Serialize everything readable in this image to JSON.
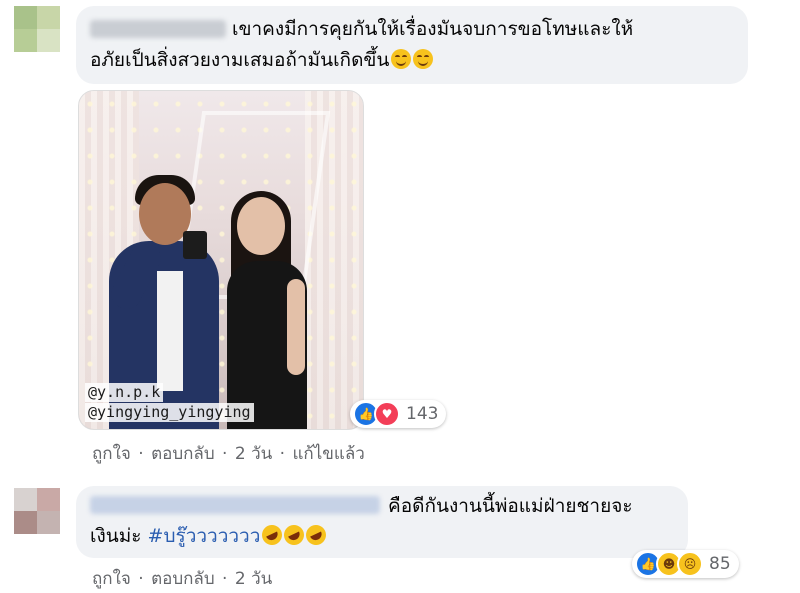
{
  "comments": [
    {
      "text_line1": "เขาคงมีการคุยกันให้เรื่องมันจบการขอโทษและให้",
      "text_line2": "อภัยเป็นสิ่งสวยงามเสมอถ้ามันเกิดขึ้น",
      "emojis": [
        "smiling-face-icon",
        "smiling-face-icon"
      ],
      "attachment": {
        "watermarks": [
          "@y.n.p.k",
          "@yingying_yingying"
        ]
      },
      "reactions": {
        "icons": [
          "like-icon",
          "love-icon"
        ],
        "count": "143"
      },
      "actions": {
        "like": "ถูกใจ",
        "reply": "ตอบกลับ",
        "time": "2 วัน",
        "edited": "แก้ไขแล้ว",
        "sep": "·"
      }
    },
    {
      "text_line1": "คือดีกันงานนี้พ่อแม่ฝ่ายชายจะ",
      "text_line2_prefix": "เงินม่ะ ",
      "hashtag": "#บรู๊ววววววว",
      "emojis": [
        "rolling-laugh-icon",
        "rolling-laugh-icon",
        "rolling-laugh-icon"
      ],
      "reactions": {
        "icons": [
          "like-icon",
          "haha-icon",
          "sad-icon"
        ],
        "count": "85"
      },
      "actions": {
        "like": "ถูกใจ",
        "reply": "ตอบกลับ",
        "time": "2 วัน",
        "sep": "·"
      }
    }
  ],
  "colors": {
    "bubble": "#f0f2f5",
    "link": "#2a5db0",
    "meta": "#65676b",
    "like_blue": "#1b74e4",
    "love_red": "#f33e58"
  }
}
